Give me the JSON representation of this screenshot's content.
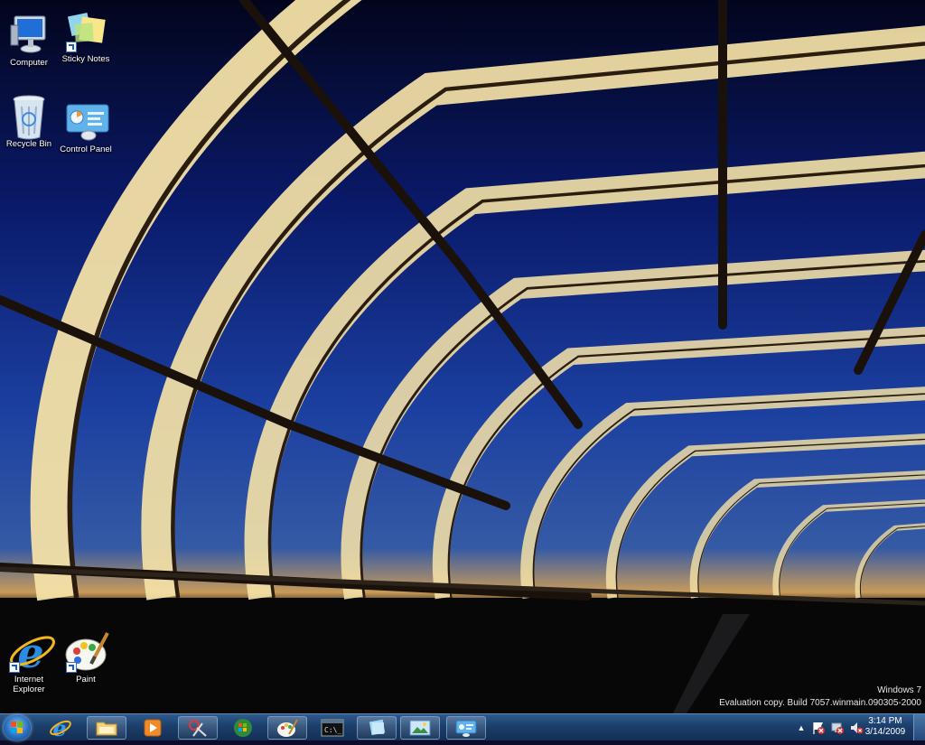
{
  "desktop": {
    "icons_top": [
      {
        "label": "Computer",
        "icon": "computer-icon"
      },
      {
        "label": "Sticky Notes",
        "icon": "sticky-notes-icon"
      },
      {
        "label": "Recycle Bin",
        "icon": "recycle-bin-icon"
      },
      {
        "label": "Control Panel",
        "icon": "control-panel-icon"
      }
    ],
    "icons_bottom": [
      {
        "label": "Internet Explorer",
        "icon": "internet-explorer-icon"
      },
      {
        "label": "Paint",
        "icon": "paint-icon"
      }
    ],
    "watermark": {
      "line1": "Windows 7",
      "line2": "Evaluation copy. Build 7057.winmain.090305-2000"
    }
  },
  "taskbar": {
    "pinned": [
      "internet-explorer-icon",
      "windows-explorer-icon",
      "media-player-icon",
      "snipping-tool-icon",
      "windows-update-icon",
      "paint-icon",
      "command-prompt-icon",
      "sticky-notes-icon",
      "photo-viewer-icon",
      "control-panel-icon"
    ],
    "clock": {
      "time": "3:14 PM",
      "date": "3/14/2009"
    }
  },
  "colors": {
    "sky_top": "#05082b",
    "sky_mid": "#0f2a8a",
    "sky_horizon": "#d9a15a",
    "arch": "#f3e0a6",
    "taskbar": "#1c3f6b"
  }
}
